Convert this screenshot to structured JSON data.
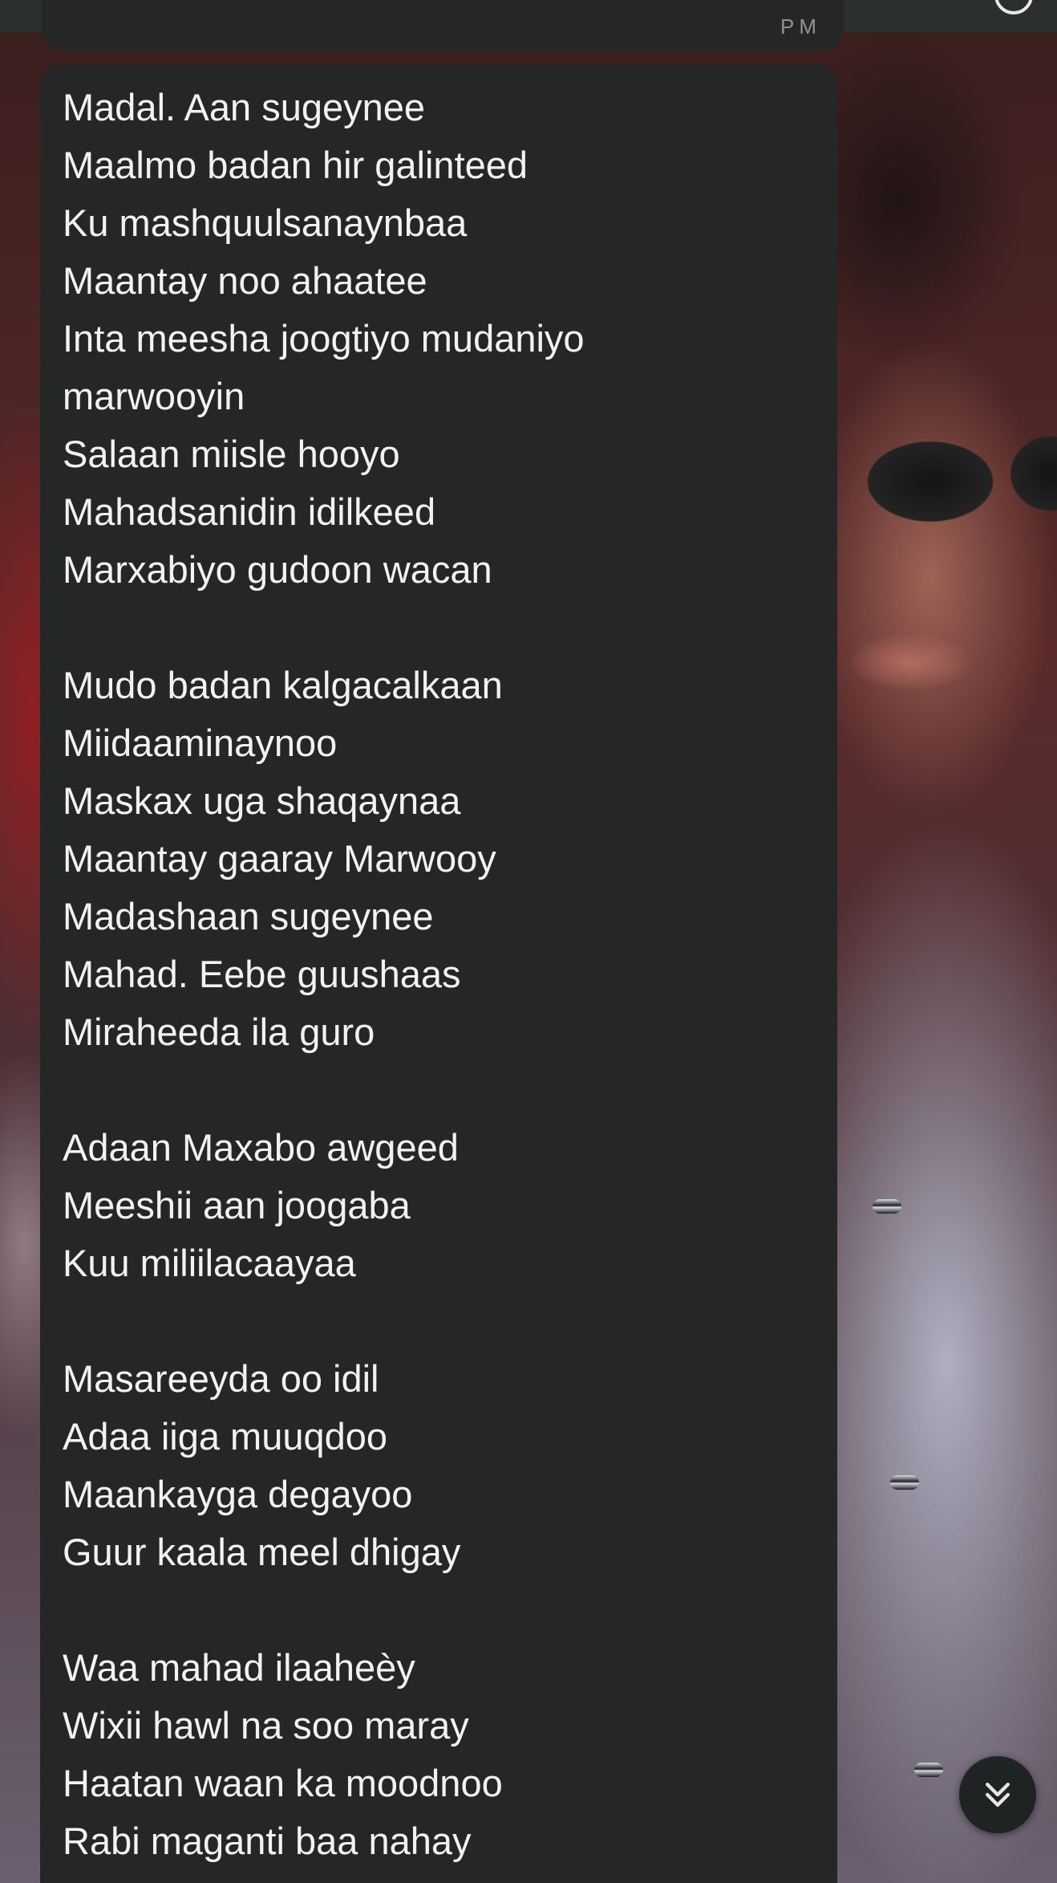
{
  "header": {
    "avatar_icon": "contact-avatar",
    "menu_icon": "more-icon"
  },
  "previous_message": {
    "time": "PM"
  },
  "message": {
    "stanzas": [
      [
        "Madal. Aan sugeynee",
        "Maalmo badan hir galinteed",
        "Ku mashquulsanaynbaa",
        "Maantay noo ahaatee",
        "Inta meesha joogtiyo mudaniyo",
        "marwooyin",
        "Salaan miisle hooyo",
        "Mahadsanidin idilkeed",
        "Marxabiyo gudoon wacan"
      ],
      [
        "Mudo badan kalgacalkaan",
        "Miidaaminaynoo",
        "Maskax uga shaqaynaa",
        "Maantay gaaray Marwooy",
        "Madashaan sugeynee",
        "Mahad. Eebe guushaas",
        "Miraheeda ila guro"
      ],
      [
        "Adaan Maxabo awgeed",
        "Meeshii aan joogaba",
        "Kuu miliilacaayaa"
      ],
      [
        "Masareeyda oo idil",
        "Adaa iiga muuqdoo",
        "Maankayga degayoo",
        "Guur kaala meel dhigay"
      ],
      [
        "Waa mahad ilaaheèy",
        "Wixii hawl na soo maray",
        "Haatan waan ka moodnoo",
        "Rabi maganti baa nahay"
      ]
    ]
  },
  "scroll_button": {
    "icon": "chevrons-down-icon"
  }
}
